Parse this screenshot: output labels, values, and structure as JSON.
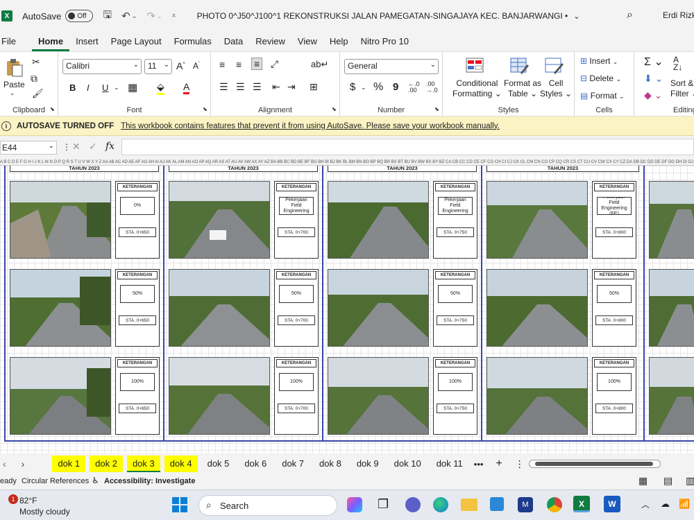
{
  "titlebar": {
    "autosave_label": "AutoSave",
    "autosave_state": "Off",
    "doc_title": "PHOTO  0^J50^J100^1  REKONSTRUKSI JALAN PAMEGATAN-SINGAJAYA KEC. BANJARWANGI •",
    "user": "Erdi Rizky"
  },
  "tabs": [
    "File",
    "Home",
    "Insert",
    "Page Layout",
    "Formulas",
    "Data",
    "Review",
    "View",
    "Help",
    "Nitro Pro 10"
  ],
  "active_tab": "Home",
  "ribbon": {
    "clipboard": {
      "label": "Clipboard",
      "paste": "Paste"
    },
    "font": {
      "label": "Font",
      "name": "Calibri",
      "size": "11",
      "bold": "B",
      "italic": "I",
      "underline": "U"
    },
    "alignment": {
      "label": "Alignment"
    },
    "number": {
      "label": "Number",
      "format": "General",
      "currency": "$",
      "percent": "%",
      "comma": "9"
    },
    "styles": {
      "label": "Styles",
      "conditional": [
        "Conditional",
        "Formatting"
      ],
      "format_table": [
        "Format as",
        "Table"
      ],
      "cell_styles": [
        "Cell",
        "Styles"
      ]
    },
    "cells": {
      "label": "Cells",
      "insert": "Insert",
      "delete": "Delete",
      "format": "Format"
    },
    "editing": {
      "label": "Editing",
      "sort": [
        "Sort &",
        "Filter"
      ]
    }
  },
  "infobar": {
    "title": "AUTOSAVE TURNED OFF",
    "message": "This workbook contains features that prevent it from using AutoSave. Please save your workbook manually."
  },
  "formula": {
    "namebox": "E44",
    "fx": "fx",
    "value": ""
  },
  "sheet": {
    "column_header_text": "A B C D E F G H I J K L M N O P Q R S T U V W X Y Z AA AB AC AD AE AF AG AH AI AJ AK AL AM AN AO AP AQ AR AS AT AU AV AW AX AY AZ BA BB BC BD BE BF BG BH BI BJ BK BL BM BN BO BP BQ BR BS BT BU BV BW BX BY BZ CA CB CC CD CE CF CG CH CI CJ CK CL CM CN CO CP CQ CR CS CT CU CV CW CX CY CZ DA DB DC DD DE DF DG DH DI DJ DK DL DM DN DO DP DQ DR DS DT DU DV DW DX DY DZ EA EB EC ED EE EF EG",
    "year_label": "TAHUN 2023",
    "ket_label": "KETERANGAN",
    "pages": [
      {
        "rows": [
          {
            "pct": "0%",
            "sta": "STA. 0+650"
          },
          {
            "pct": "50%",
            "sta": "STA. 0+650"
          },
          {
            "pct": "100%",
            "sta": "STA. 0+650"
          }
        ]
      },
      {
        "rows": [
          {
            "pct": "Pekerjaan Field Engineering",
            "sta": "STA. 0+700"
          },
          {
            "pct": "50%",
            "sta": "STA. 0+700"
          },
          {
            "pct": "100%",
            "sta": "STA. 0+700"
          }
        ]
      },
      {
        "rows": [
          {
            "pct": "Pekerjaan Field Engineering",
            "sta": "STA. 0+750"
          },
          {
            "pct": "50%",
            "sta": "STA. 0+750"
          },
          {
            "pct": "100%",
            "sta": "STA. 0+750"
          }
        ]
      },
      {
        "rows": [
          {
            "pct": "Pekerjaan Field Engineering (FE)",
            "sta": "STA. 0+800"
          },
          {
            "pct": "50%",
            "sta": "STA. 0+800"
          },
          {
            "pct": "100%",
            "sta": "STA. 0+800"
          }
        ]
      }
    ]
  },
  "sheet_tabs": [
    {
      "name": "dok 1",
      "highlight": true
    },
    {
      "name": "dok 2",
      "highlight": true
    },
    {
      "name": "dok 3",
      "highlight": true,
      "active": true
    },
    {
      "name": "dok 4",
      "highlight": true
    },
    {
      "name": "dok 5"
    },
    {
      "name": "dok 6"
    },
    {
      "name": "dok 7"
    },
    {
      "name": "dok 8"
    },
    {
      "name": "dok 9"
    },
    {
      "name": "dok 10"
    },
    {
      "name": "dok 11"
    }
  ],
  "statusbar": {
    "ready": "eady",
    "circular": "Circular References",
    "accessibility": "Accessibility: Investigate"
  },
  "taskbar": {
    "weather_temp": "82°F",
    "weather_desc": "Mostly cloudy",
    "weather_badge": "1",
    "search": "Search"
  }
}
